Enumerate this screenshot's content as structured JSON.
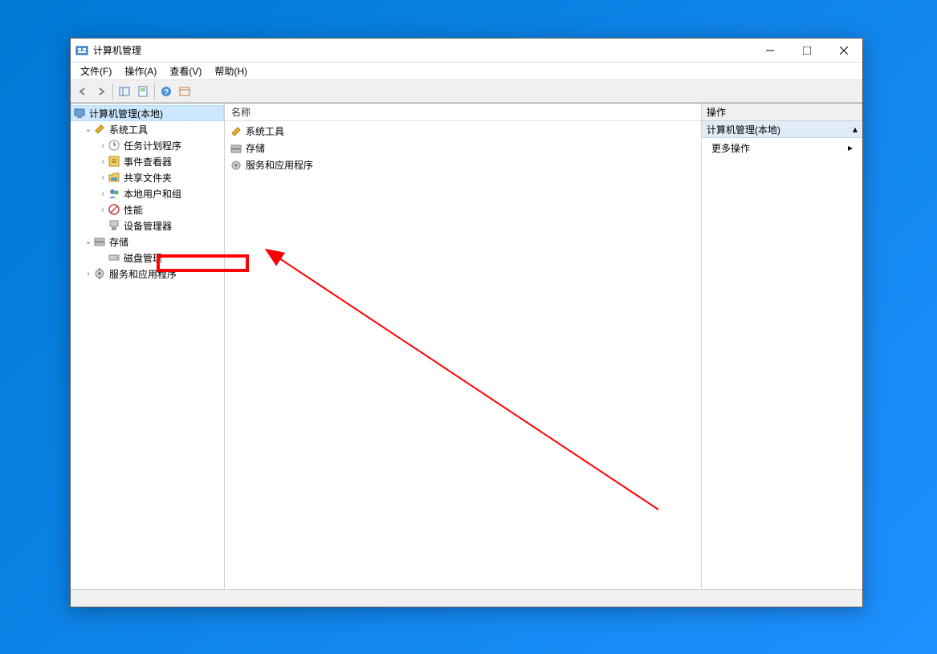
{
  "window": {
    "title": "计算机管理"
  },
  "menu": {
    "file": "文件(F)",
    "action": "操作(A)",
    "view": "查看(V)",
    "help": "帮助(H)"
  },
  "tree": {
    "root": "计算机管理(本地)",
    "systools": "系统工具",
    "task_scheduler": "任务计划程序",
    "event_viewer": "事件查看器",
    "shared_folders": "共享文件夹",
    "local_users": "本地用户和组",
    "performance": "性能",
    "device_manager": "设备管理器",
    "storage": "存储",
    "disk_management": "磁盘管理",
    "services_apps": "服务和应用程序"
  },
  "list": {
    "header_name": "名称",
    "systools": "系统工具",
    "storage": "存储",
    "services_apps": "服务和应用程序"
  },
  "actions": {
    "header": "操作",
    "section_title": "计算机管理(本地)",
    "more_actions": "更多操作"
  }
}
